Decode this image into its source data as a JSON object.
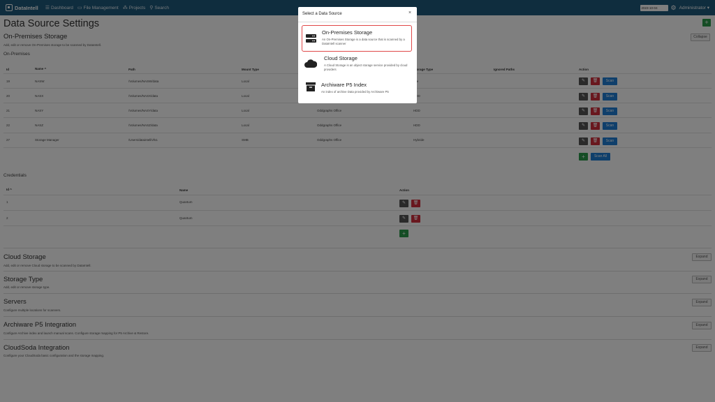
{
  "nav": {
    "brand": "DataIntell",
    "links": [
      {
        "label": "Dashboard",
        "icon": "dashboard-icon"
      },
      {
        "label": "File Management",
        "icon": "folder-icon"
      },
      {
        "label": "Projects",
        "icon": "projects-icon"
      },
      {
        "label": "Search",
        "icon": "search-icon"
      }
    ],
    "date": "2023-10-04",
    "user": "Administrator"
  },
  "page": {
    "title": "Data Source Settings",
    "add_label": "+"
  },
  "onprem": {
    "title": "On-Premises Storage",
    "subtitle": "Add, edit or remove On-Premises storage to be scanned by DataIntell.",
    "collapse_label": "Collapse",
    "table_heading": "On-Premises",
    "headers": {
      "id": "Id",
      "name": "Name ^",
      "path": "Path",
      "mount": "Mount Type",
      "tiering": "",
      "storage": "Storage Type",
      "ignored": "Ignored Paths",
      "action": "Action"
    },
    "rows": [
      {
        "id": "19",
        "name": "NASW",
        "path": "/Volumes/NASW/data",
        "mount": "Local",
        "tiering": "",
        "storage": "File"
      },
      {
        "id": "20",
        "name": "NASX",
        "path": "/Volumes/NASX/data",
        "mount": "Local",
        "tiering": "",
        "storage": "HDD"
      },
      {
        "id": "21",
        "name": "NASY",
        "path": "/Volumes/NASY/data",
        "mount": "Local",
        "tiering": "Oddgraphs Office",
        "storage": "HDD"
      },
      {
        "id": "22",
        "name": "NASZ",
        "path": "/Volumes/NASZ/data",
        "mount": "Local",
        "tiering": "Oddgraphs Office",
        "storage": "HDD"
      },
      {
        "id": "27",
        "name": "Storage Manager",
        "path": "/Users/dataintell/vfs1",
        "mount": "SMB",
        "tiering": "Oddgraphs Office",
        "storage": "Hybride"
      }
    ],
    "scan_label": "Scan",
    "scan_all_label": "Scan All",
    "plus_label": "+"
  },
  "credentials": {
    "heading": "Credentials",
    "headers": {
      "id": "Id ^",
      "name": "Name",
      "action": "Action"
    },
    "rows": [
      {
        "id": "1",
        "name": "Quantum"
      },
      {
        "id": "2",
        "name": "Quantum"
      }
    ],
    "plus_label": "+"
  },
  "sections": [
    {
      "title": "Cloud Storage",
      "subtitle": "Add, edit or remove Cloud storage to be scanned by DataIntell.",
      "button": "Expand"
    },
    {
      "title": "Storage Type",
      "subtitle": "Add, edit or remove storage type.",
      "button": "Expand"
    },
    {
      "title": "Servers",
      "subtitle": "Configure multiple locations for scanners.",
      "button": "Expand"
    },
    {
      "title": "Archiware P5 Integration",
      "subtitle": "Configure Archive index and launch manual scans. Configure storage mapping for P5 Archive & Restore.",
      "button": "Expand"
    },
    {
      "title": "CloudSoda Integration",
      "subtitle": "Configure your CloudSoda basic configuration and the storage mapping.",
      "button": "Expand"
    }
  ],
  "modal": {
    "title": "Select a Data Source",
    "close": "×",
    "options": [
      {
        "title": "On-Premises Storage",
        "desc": "An On-Premises Storage is a data source that is scanned by a DataIntell scanner",
        "icon": "server-icon"
      },
      {
        "title": "Cloud Storage",
        "desc": "A Cloud Storage is an object storage service provided by cloud providers",
        "icon": "cloud-icon"
      },
      {
        "title": "Archiware P5 Index",
        "desc": "An index of archive Data provided by Archiware P5",
        "icon": "archive-icon"
      }
    ]
  },
  "colors": {
    "topbar": "#1f5a7c",
    "add": "#2a9a4a",
    "delete": "#d32f3c",
    "scan": "#1e7fd6",
    "selected_border": "#e04848"
  }
}
